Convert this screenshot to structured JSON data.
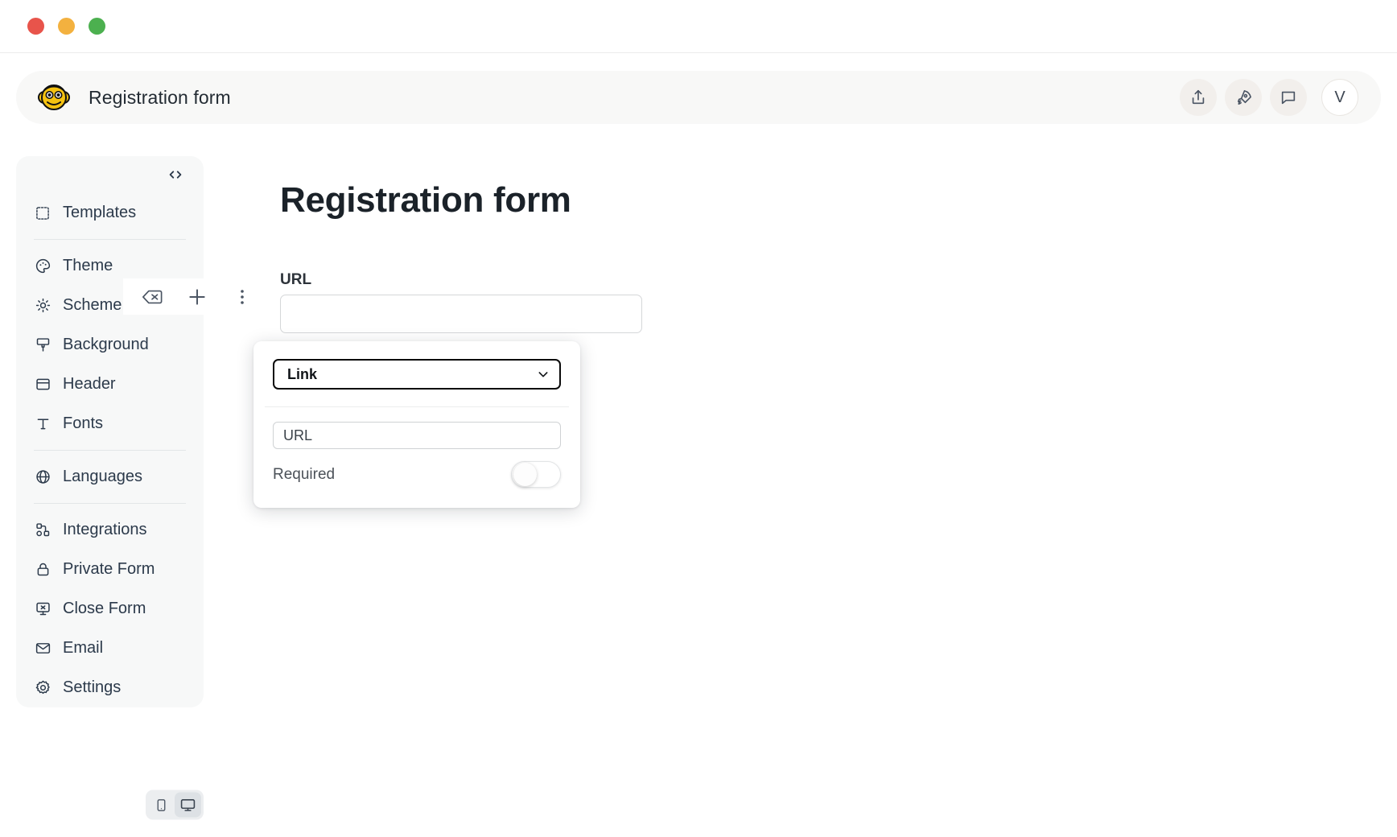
{
  "window": {
    "traffic_lights": [
      {
        "name": "close",
        "color": "#e8544b"
      },
      {
        "name": "minimize",
        "color": "#f3b13f"
      },
      {
        "name": "maximize",
        "color": "#4cb04f"
      }
    ]
  },
  "header": {
    "logo_alt": "monkey-avatar",
    "title": "Registration form",
    "actions": [
      {
        "name": "share-icon",
        "label": "Share"
      },
      {
        "name": "publish-rocket-icon",
        "label": "Publish"
      },
      {
        "name": "comment-icon",
        "label": "Comments"
      }
    ],
    "avatar_initial": "V"
  },
  "sidebar": {
    "code_icon_label": "<>",
    "groups": [
      {
        "items": [
          {
            "label": "Templates",
            "icon": "templates-icon"
          }
        ]
      },
      {
        "items": [
          {
            "label": "Theme",
            "icon": "palette-icon"
          },
          {
            "label": "Scheme",
            "icon": "scheme-icon"
          },
          {
            "label": "Background",
            "icon": "brush-icon"
          },
          {
            "label": "Header",
            "icon": "header-icon"
          },
          {
            "label": "Fonts",
            "icon": "fonts-icon"
          }
        ]
      },
      {
        "items": [
          {
            "label": "Languages",
            "icon": "globe-icon"
          }
        ]
      },
      {
        "items": [
          {
            "label": "Integrations",
            "icon": "integrations-icon"
          },
          {
            "label": "Private Form",
            "icon": "lock-icon"
          },
          {
            "label": "Close Form",
            "icon": "close-form-icon"
          },
          {
            "label": "Email",
            "icon": "email-icon"
          },
          {
            "label": "Settings",
            "icon": "gear-icon"
          }
        ]
      }
    ]
  },
  "device_toggle": {
    "options": [
      {
        "name": "mobile",
        "label": "Mobile",
        "active": false
      },
      {
        "name": "desktop",
        "label": "Desktop",
        "active": true
      }
    ]
  },
  "canvas": {
    "form_title": "Registration form",
    "field": {
      "label": "URL",
      "value": "",
      "placeholder": ""
    },
    "toolbar": [
      {
        "name": "delete-field-icon",
        "label": "Delete field"
      },
      {
        "name": "add-field-icon",
        "label": "Add field"
      },
      {
        "name": "more-options-icon",
        "label": "More options"
      }
    ]
  },
  "popover": {
    "field_type": "Link",
    "field_type_options": [
      "Link"
    ],
    "label_input_value": "URL",
    "label_input_placeholder": "URL",
    "required_label": "Required",
    "required_on": false
  }
}
